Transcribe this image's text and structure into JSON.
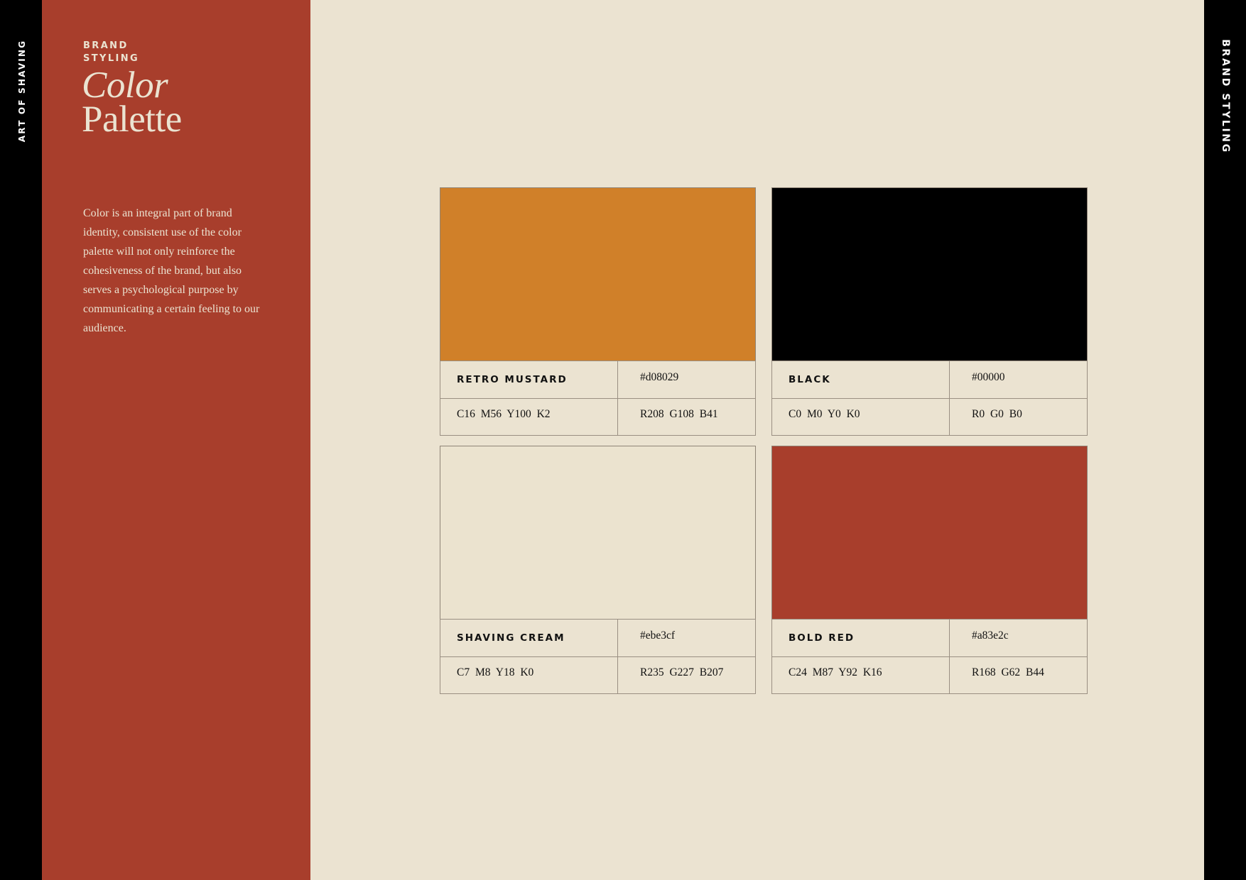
{
  "side_labels": {
    "left": "ART OF SHAVING",
    "right": "BRAND STYLING"
  },
  "header": {
    "kicker_line1": "BRAND",
    "kicker_line2": "STYLING",
    "title_line1": "Color",
    "title_line2": "Palette"
  },
  "intro": "Color is an integral part of brand identity, consistent use of the color palette will not only reinforce the cohesiveness of the brand, but also serves a psychological purpose by communicating  a certain feeling to our audience.",
  "colors": {
    "background": "#ebe3d1",
    "sidebar": "#a83e2c",
    "strip": "#000000",
    "text_on_sidebar": "#ebe3d1"
  },
  "swatches": [
    {
      "name": "RETRO MUSTARD",
      "hex": "#d08029",
      "cmyk": "C16  M56  Y100  K2",
      "rgb": "R208  G108  B41",
      "fill": "#d08029"
    },
    {
      "name": "BLACK",
      "hex": "#00000",
      "cmyk": "C0  M0  Y0  K0",
      "rgb": "R0  G0  B0",
      "fill": "#000000"
    },
    {
      "name": "SHAVING CREAM",
      "hex": "#ebe3cf",
      "cmyk": "C7  M8  Y18  K0",
      "rgb": "R235  G227  B207",
      "fill": "#ebe3cf"
    },
    {
      "name": "BOLD RED",
      "hex": "#a83e2c",
      "cmyk": "C24  M87  Y92  K16",
      "rgb": "R168  G62  B44",
      "fill": "#a83e2c"
    }
  ]
}
